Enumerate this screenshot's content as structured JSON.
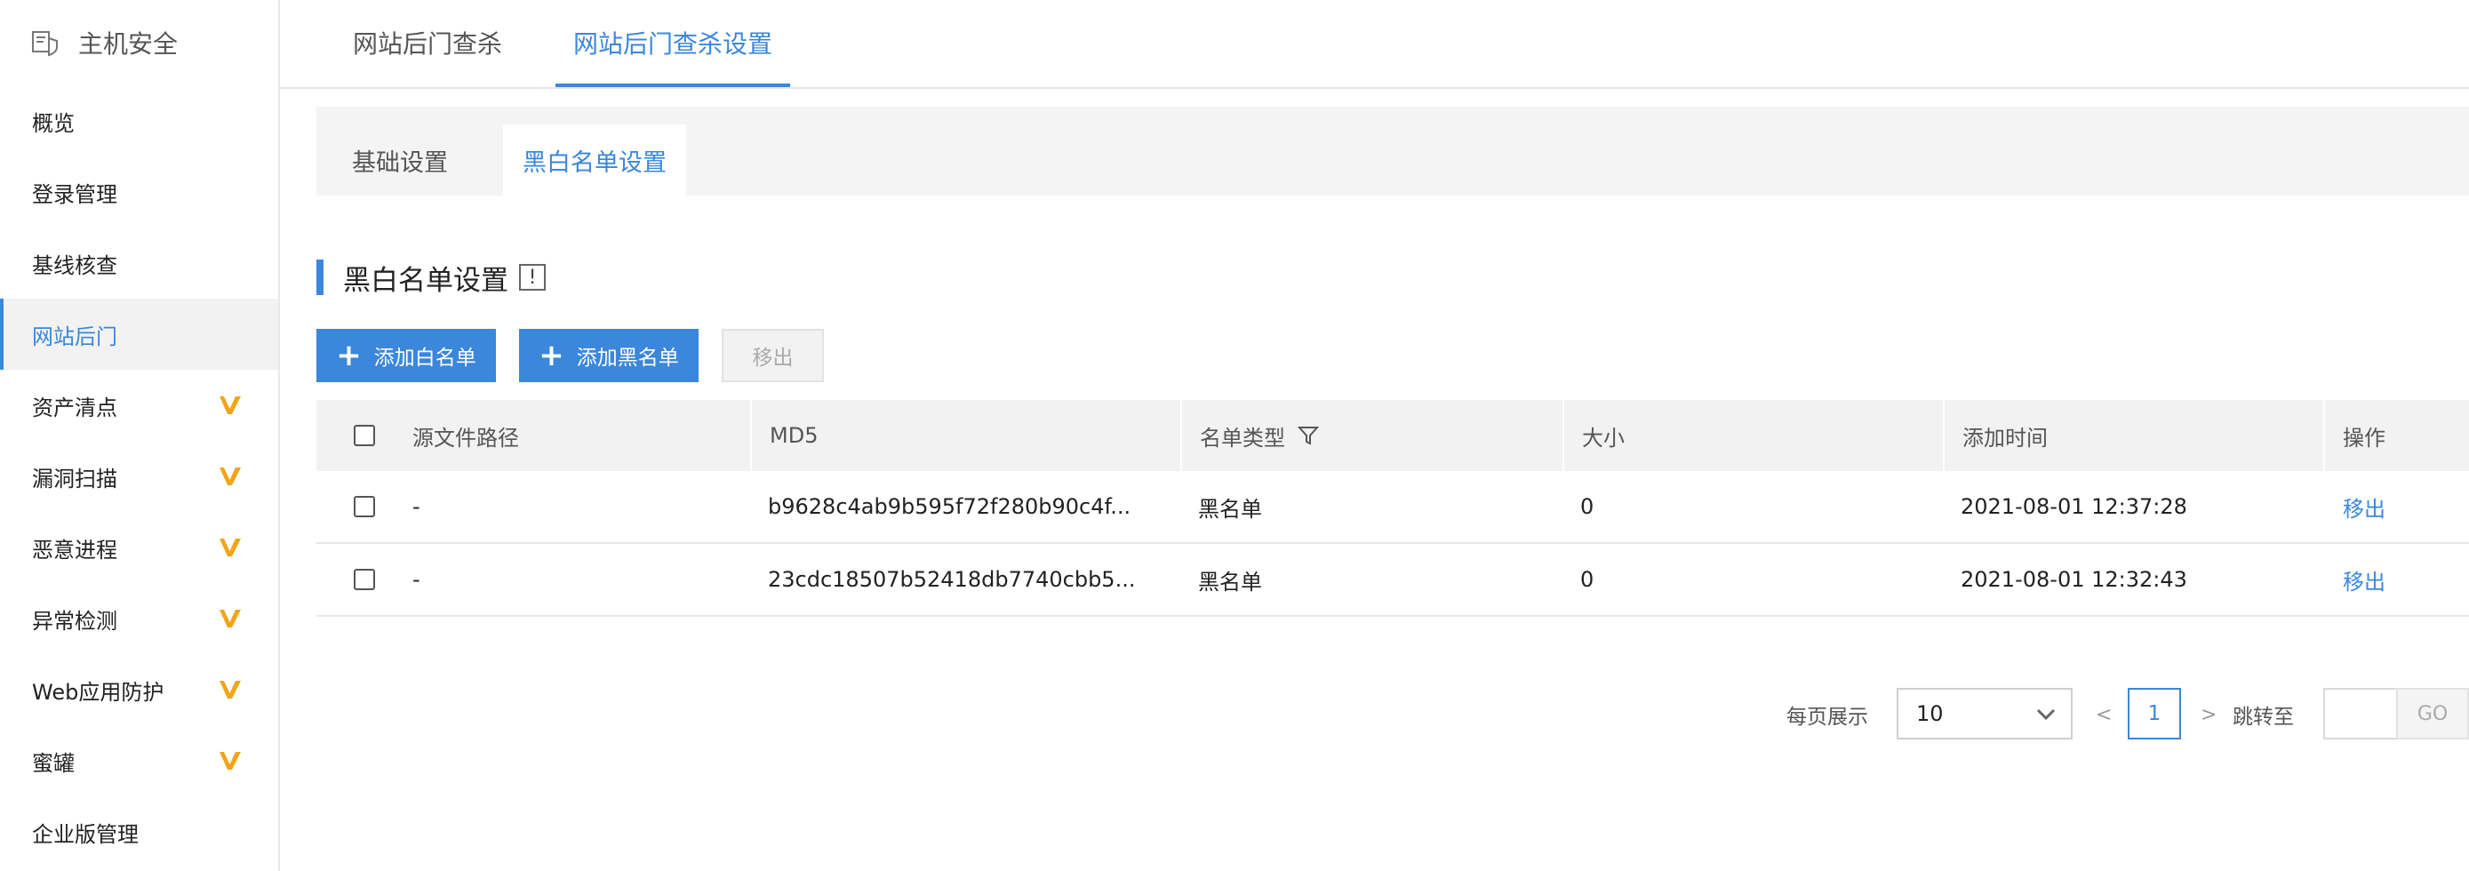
{
  "sidebar": {
    "title": "主机安全",
    "items": [
      {
        "label": "概览",
        "badge": false
      },
      {
        "label": "登录管理",
        "badge": false
      },
      {
        "label": "基线核查",
        "badge": false
      },
      {
        "label": "网站后门",
        "badge": false,
        "active": true
      },
      {
        "label": "资产清点",
        "badge": true
      },
      {
        "label": "漏洞扫描",
        "badge": true
      },
      {
        "label": "恶意进程",
        "badge": true
      },
      {
        "label": "异常检测",
        "badge": true
      },
      {
        "label": "Web应用防护",
        "badge": true
      },
      {
        "label": "蜜罐",
        "badge": true
      },
      {
        "label": "企业版管理",
        "badge": false
      }
    ],
    "badge_color": "#f0a51a"
  },
  "top_tabs": [
    {
      "label": "网站后门查杀"
    },
    {
      "label": "网站后门查杀设置",
      "active": true
    }
  ],
  "sub_tabs": [
    {
      "label": "基础设置"
    },
    {
      "label": "黑白名单设置",
      "active": true
    }
  ],
  "section": {
    "title": "黑白名单设置",
    "info_icon": "!"
  },
  "buttons": {
    "add_white": "添加白名单",
    "add_black": "添加黑名单",
    "remove": "移出"
  },
  "table": {
    "headers": [
      "源文件路径",
      "MD5",
      "名单类型",
      "大小",
      "添加时间",
      "操作"
    ],
    "rows": [
      {
        "path": "-",
        "md5": "b9628c4ab9b595f72f280b90c4f...",
        "type": "黑名单",
        "size": "0",
        "time": "2021-08-01 12:37:28",
        "action": "移出"
      },
      {
        "path": "-",
        "md5": "23cdc18507b52418db7740cbb5...",
        "type": "黑名单",
        "size": "0",
        "time": "2021-08-01 12:32:43",
        "action": "移出"
      }
    ]
  },
  "pagination": {
    "per_page_label": "每页展示",
    "per_page_value": "10",
    "prev": "<",
    "next": ">",
    "current_page": "1",
    "jump_label": "跳转至",
    "go": "GO"
  },
  "colors": {
    "accent": "#3a87dc"
  }
}
